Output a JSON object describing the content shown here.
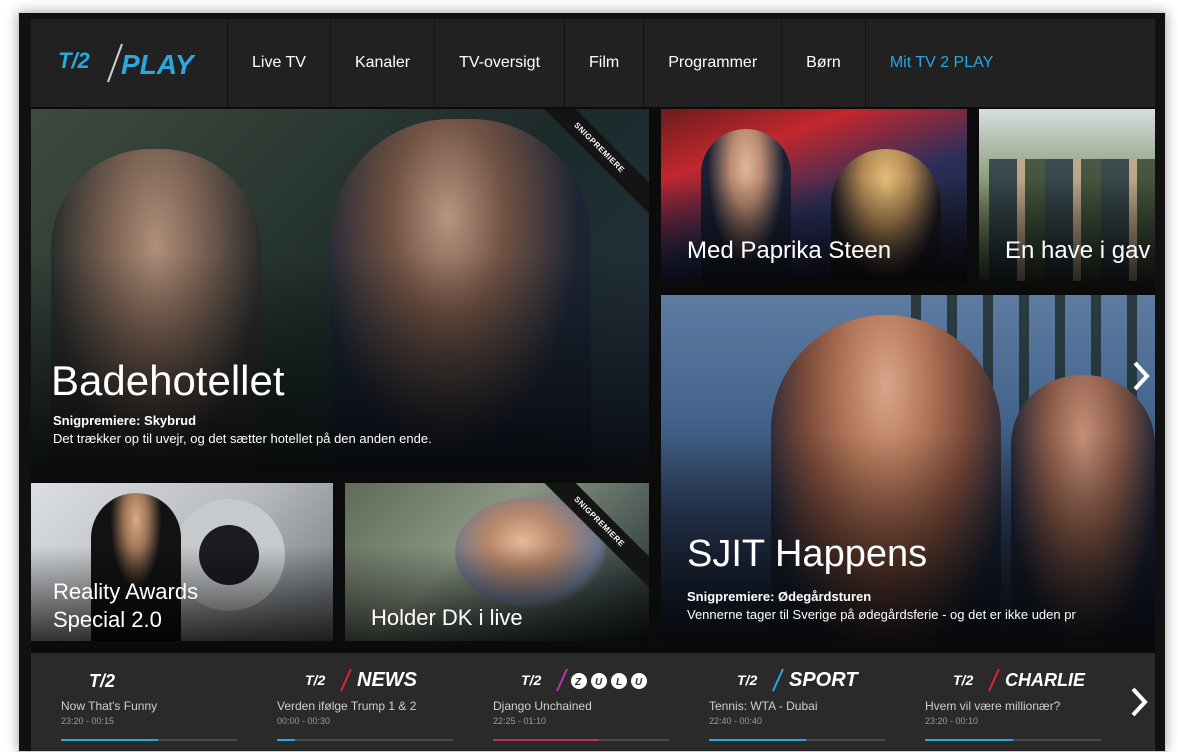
{
  "nav": {
    "logo_play": "PLAY",
    "items": [
      {
        "label": "Live TV"
      },
      {
        "label": "Kanaler"
      },
      {
        "label": "TV-oversigt"
      },
      {
        "label": "Film"
      },
      {
        "label": "Programmer"
      },
      {
        "label": "Børn"
      },
      {
        "label": "Mit TV 2 PLAY"
      }
    ]
  },
  "hero": {
    "title": "Badehotellet",
    "subtitle": "Snigpremiere: Skybrud",
    "description": "Det trækker op til uvejr, og det sætter hotellet på den anden ende.",
    "ribbon": "SNIGPREMIERE"
  },
  "tiles": {
    "paprika": {
      "title": "Med Paprika Steen"
    },
    "have": {
      "title": "En have i gav"
    },
    "sjit": {
      "title": "SJIT Happens",
      "subtitle": "Snigpremiere: Ødegårdsturen",
      "description": "Vennerne tager til Sverige på ødegårdsferie - og det er ikke uden pr"
    },
    "reality": {
      "title_line1": "Reality Awards",
      "title_line2": "Special 2.0"
    },
    "holder": {
      "title": "Holder DK i live",
      "ribbon": "SNIGPREMIERE"
    }
  },
  "channels": [
    {
      "logo_suffix": "",
      "program": "Now That's Funny",
      "time": "23:20 - 00:15",
      "progress": 0.55
    },
    {
      "logo_suffix": "NEWS",
      "program": "Verden ifølge Trump 1 & 2",
      "time": "00:00 - 00:30",
      "progress": 0.1
    },
    {
      "logo_suffix": "ZULU",
      "program": "Django Unchained",
      "time": "22:25 - 01:10",
      "progress": 0.6
    },
    {
      "logo_suffix": "SPORT",
      "program": "Tennis: WTA - Dubai",
      "time": "22:40 - 00:40",
      "progress": 0.55
    },
    {
      "logo_suffix": "CHARLIE",
      "program": "Hvem vil være millionær?",
      "time": "23:20 - 00:10",
      "progress": 0.5
    }
  ],
  "colors": {
    "accent": "#2aa7e0",
    "nav_bg": "#212121",
    "strip_bg": "#2a2a2a",
    "news": "#e0242c",
    "zulu": "#c32ebd",
    "sport": "#2aa7e0",
    "charlie": "#e0242c"
  },
  "icons": {
    "next": "chevron-right-icon"
  }
}
